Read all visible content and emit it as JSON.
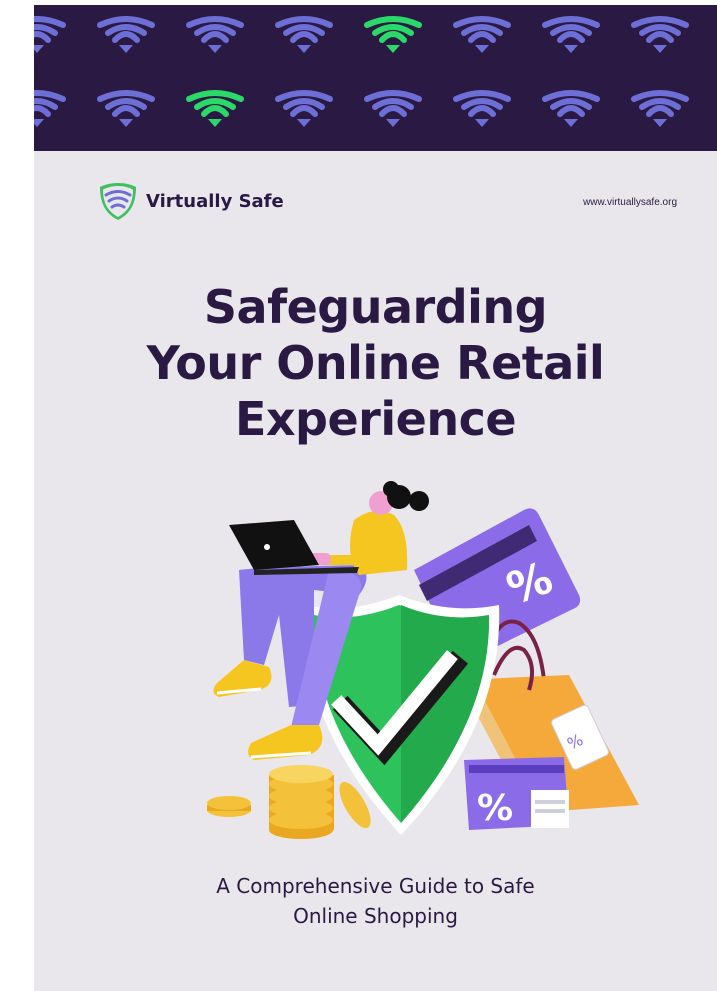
{
  "header": {
    "brand_name": "Virtually Safe",
    "website": "www.virtuallysafe.org",
    "pattern_icon": "wifi-signal-icon",
    "pattern_colors": {
      "default": "#6d6fd6",
      "highlight": "#2bd96b",
      "background": "#2a1a43"
    }
  },
  "cover": {
    "title_lines": [
      "Safeguarding",
      "Your Online Retail",
      "Experience"
    ],
    "subtitle_lines": [
      "A Comprehensive Guide to Safe",
      "Online Shopping"
    ]
  },
  "illustration": {
    "elements": [
      "woman-with-laptop",
      "shield-check-icon",
      "credit-card-icon",
      "shopping-bag-icon",
      "coupon-icon",
      "coins-icon"
    ],
    "card_text": "%",
    "coupon_text": "%",
    "tag_text": "%",
    "colors": {
      "shield": "#2ec25d",
      "card": "#8b6be8",
      "bag": "#f5a93a",
      "text": "#2a1a43"
    }
  }
}
